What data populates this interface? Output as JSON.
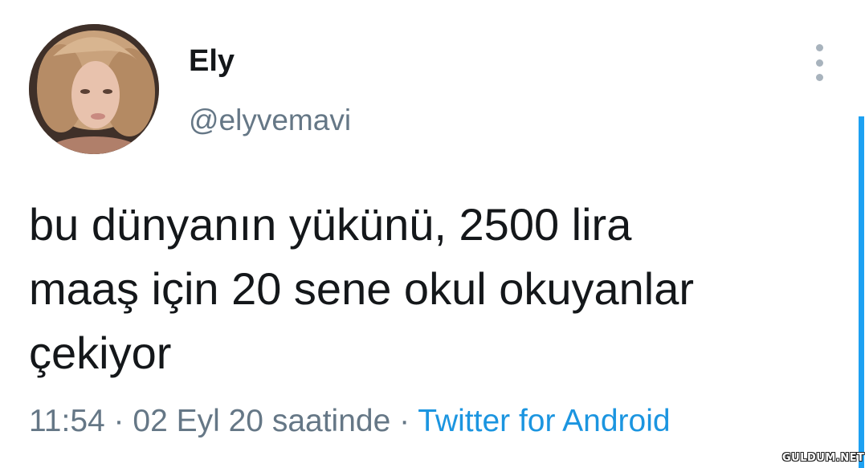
{
  "user": {
    "display_name": "Ely",
    "handle": "@elyvemavi",
    "avatar_icon": "profile-photo"
  },
  "tweet": {
    "text_lines": [
      "bu dünyanın yükünü, 2500 lira",
      "maaş için 20 sene okul okuyanlar",
      "çekiyor"
    ],
    "time": "11:54",
    "separator": "·",
    "date": "02 Eyl 20 saatinde",
    "source": "Twitter for Android"
  },
  "menu": {
    "more_icon": "vertical-ellipsis-icon"
  },
  "colors": {
    "text": "#14171a",
    "secondary": "#657786",
    "link": "#1b95e0",
    "accent": "#1da1f2"
  },
  "watermark": {
    "text": "GULDUM.NET"
  }
}
